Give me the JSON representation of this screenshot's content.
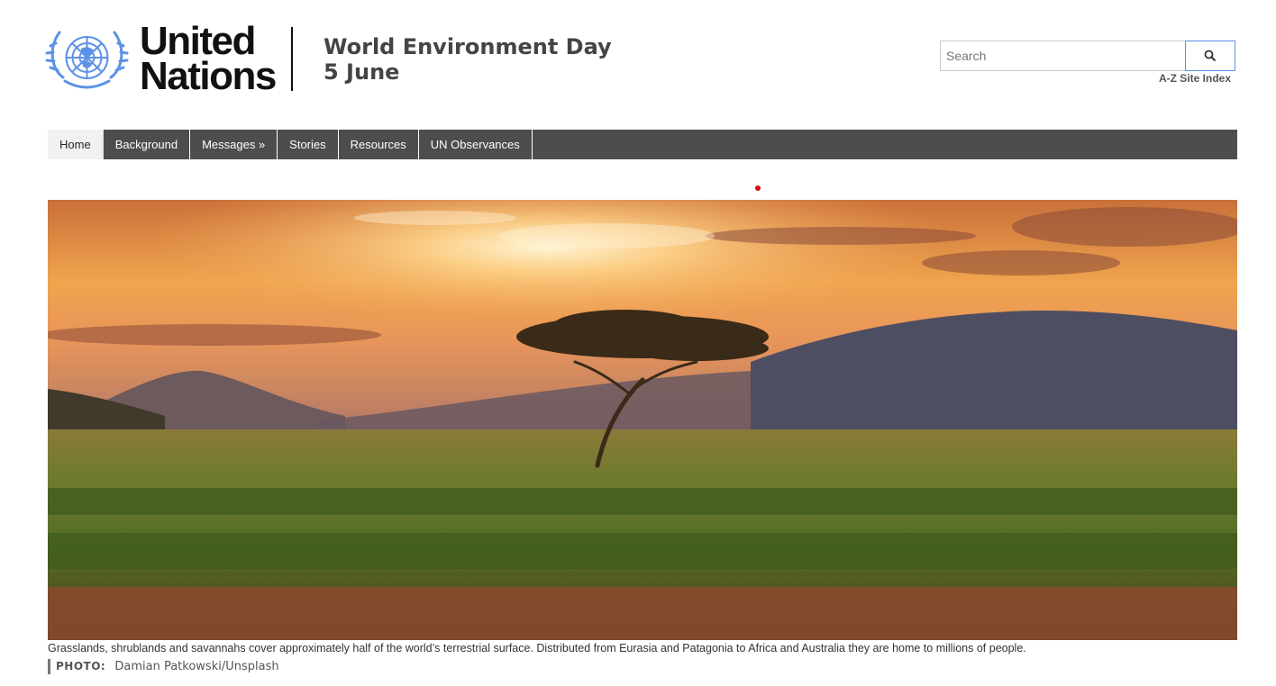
{
  "header": {
    "logo_line1": "United",
    "logo_line2": "Nations",
    "site_title_line1": "World Environment Day",
    "site_title_line2": "5 June",
    "search_placeholder": "Search",
    "az_index": "A-Z Site Index"
  },
  "nav": {
    "items": [
      {
        "label": "Home",
        "active": true
      },
      {
        "label": "Background"
      },
      {
        "label": "Messages »"
      },
      {
        "label": "Stories"
      },
      {
        "label": "Resources"
      },
      {
        "label": "UN Observances"
      }
    ]
  },
  "hero": {
    "caption": "Grasslands, shrublands and savannahs cover approximately half of the world’s terrestrial surface. Distributed from Eurasia and Patagonia to Africa and Australia they are home to millions of people.",
    "photo_label": "PHOTO:",
    "photo_credit": "Damian Patkowski/Unsplash"
  },
  "colors": {
    "un_blue": "#5b92e5",
    "nav_bg": "#4d4d4d",
    "accent_red": "#d10a11"
  },
  "icons": {
    "emblem": "un-emblem-icon",
    "search": "search-icon"
  }
}
